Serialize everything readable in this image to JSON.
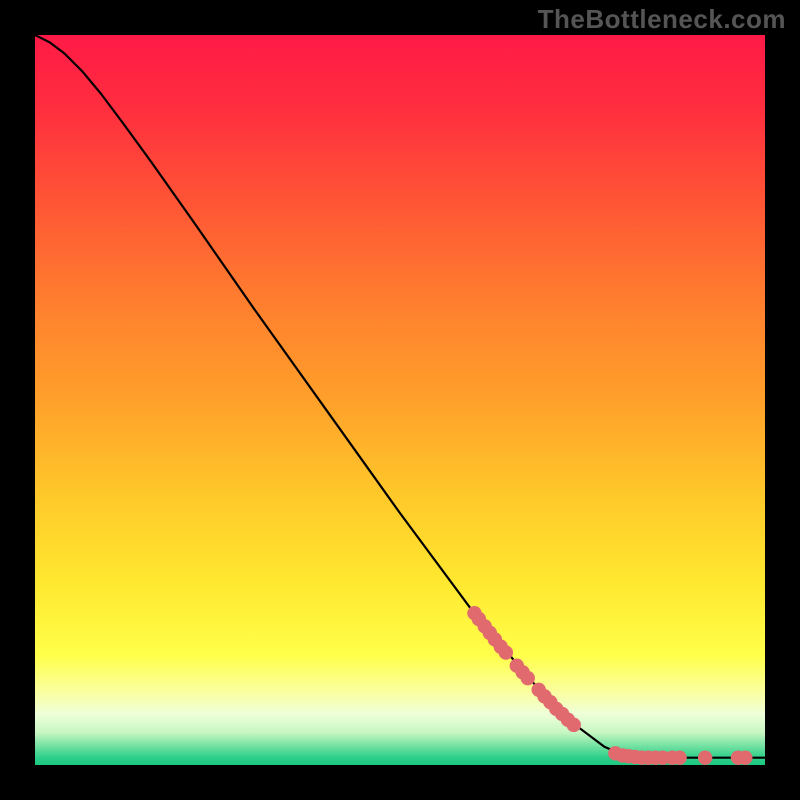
{
  "watermark": "TheBottleneck.com",
  "colors": {
    "background_black": "#000000",
    "line": "#000000",
    "marker": "#e16a6f",
    "watermark": "#555555"
  },
  "chart_data": {
    "type": "line",
    "title": "",
    "xlabel": "",
    "ylabel": "",
    "xlim": [
      0,
      100
    ],
    "ylim": [
      0,
      100
    ],
    "background_gradient_stops": [
      {
        "offset": 0.0,
        "color": "#ff1a46"
      },
      {
        "offset": 0.1,
        "color": "#ff2e3f"
      },
      {
        "offset": 0.22,
        "color": "#ff5236"
      },
      {
        "offset": 0.35,
        "color": "#ff7a2f"
      },
      {
        "offset": 0.5,
        "color": "#ffa02a"
      },
      {
        "offset": 0.63,
        "color": "#ffc82a"
      },
      {
        "offset": 0.75,
        "color": "#ffe82f"
      },
      {
        "offset": 0.85,
        "color": "#ffff4a"
      },
      {
        "offset": 0.9,
        "color": "#faffa0"
      },
      {
        "offset": 0.93,
        "color": "#efffd8"
      },
      {
        "offset": 0.955,
        "color": "#c8f7c2"
      },
      {
        "offset": 0.975,
        "color": "#6ee0a0"
      },
      {
        "offset": 0.99,
        "color": "#2ccf8a"
      },
      {
        "offset": 1.0,
        "color": "#1cc880"
      }
    ],
    "curve": [
      {
        "x": 0.0,
        "y": 100.0
      },
      {
        "x": 2.0,
        "y": 99.0
      },
      {
        "x": 4.0,
        "y": 97.5
      },
      {
        "x": 6.5,
        "y": 95.0
      },
      {
        "x": 9.0,
        "y": 92.0
      },
      {
        "x": 12.0,
        "y": 88.0
      },
      {
        "x": 16.0,
        "y": 82.5
      },
      {
        "x": 22.0,
        "y": 74.0
      },
      {
        "x": 30.0,
        "y": 62.5
      },
      {
        "x": 40.0,
        "y": 48.5
      },
      {
        "x": 50.0,
        "y": 34.5
      },
      {
        "x": 60.0,
        "y": 21.0
      },
      {
        "x": 68.0,
        "y": 11.5
      },
      {
        "x": 74.0,
        "y": 5.5
      },
      {
        "x": 78.0,
        "y": 2.5
      },
      {
        "x": 81.0,
        "y": 1.2
      },
      {
        "x": 84.0,
        "y": 1.0
      },
      {
        "x": 90.0,
        "y": 1.0
      },
      {
        "x": 100.0,
        "y": 1.0
      }
    ],
    "markers": [
      {
        "x": 60.2,
        "y": 20.8
      },
      {
        "x": 60.8,
        "y": 20.0
      },
      {
        "x": 61.6,
        "y": 19.0
      },
      {
        "x": 62.3,
        "y": 18.1
      },
      {
        "x": 63.0,
        "y": 17.2
      },
      {
        "x": 63.8,
        "y": 16.2
      },
      {
        "x": 64.5,
        "y": 15.4
      },
      {
        "x": 66.0,
        "y": 13.6
      },
      {
        "x": 66.8,
        "y": 12.7
      },
      {
        "x": 67.5,
        "y": 11.9
      },
      {
        "x": 69.0,
        "y": 10.3
      },
      {
        "x": 69.8,
        "y": 9.4
      },
      {
        "x": 70.6,
        "y": 8.6
      },
      {
        "x": 71.4,
        "y": 7.7
      },
      {
        "x": 72.2,
        "y": 7.0
      },
      {
        "x": 73.0,
        "y": 6.2
      },
      {
        "x": 73.8,
        "y": 5.5
      },
      {
        "x": 79.5,
        "y": 1.6
      },
      {
        "x": 80.5,
        "y": 1.3
      },
      {
        "x": 81.3,
        "y": 1.2
      },
      {
        "x": 82.2,
        "y": 1.1
      },
      {
        "x": 83.1,
        "y": 1.0
      },
      {
        "x": 84.0,
        "y": 1.0
      },
      {
        "x": 85.0,
        "y": 1.0
      },
      {
        "x": 86.0,
        "y": 1.0
      },
      {
        "x": 87.3,
        "y": 1.0
      },
      {
        "x": 88.3,
        "y": 1.0
      },
      {
        "x": 91.8,
        "y": 1.0
      },
      {
        "x": 96.3,
        "y": 1.0
      },
      {
        "x": 97.3,
        "y": 1.0
      }
    ]
  }
}
